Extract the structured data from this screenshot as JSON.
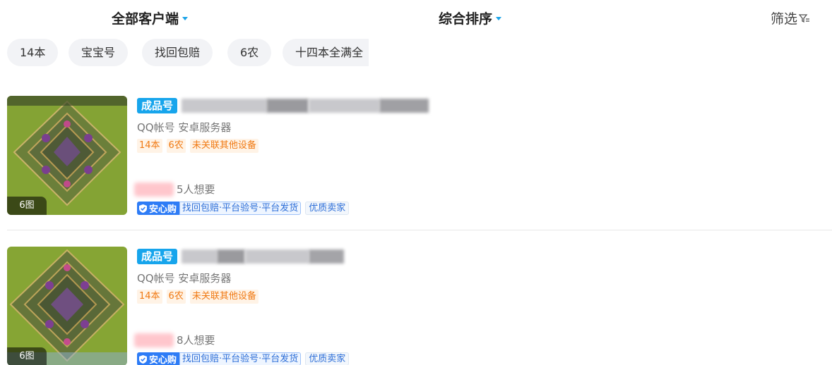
{
  "header": {
    "client_filter_label": "全部客户端",
    "sort_label": "综合排序",
    "filter_label": "筛选"
  },
  "tags": [
    "14本",
    "宝宝号",
    "找回包赔",
    "6农",
    "十四本全满全"
  ],
  "listings": [
    {
      "image_count": "6图",
      "badge": "成品号",
      "subtitle": "QQ帐号 安卓服务器",
      "attributes": [
        "14本",
        "6农",
        "未关联其他设备"
      ],
      "want_count": "5人想要",
      "guarantee_label": "安心购",
      "guarantee_items": "找回包赔·平台验号·平台发货",
      "seller_tag": "优质卖家"
    },
    {
      "image_count": "6图",
      "badge": "成品号",
      "subtitle": "QQ帐号 安卓服务器",
      "attributes": [
        "14本",
        "6农",
        "未关联其他设备"
      ],
      "want_count": "8人想要",
      "guarantee_label": "安心购",
      "guarantee_items": "找回包赔·平台验号·平台发货",
      "seller_tag": "优质卖家"
    }
  ],
  "colors": {
    "accent_blue": "#17a5ec",
    "attr_orange": "#f07a14",
    "guarantee_blue": "#2e7cf6",
    "tag_bg": "#f2f3f6"
  }
}
